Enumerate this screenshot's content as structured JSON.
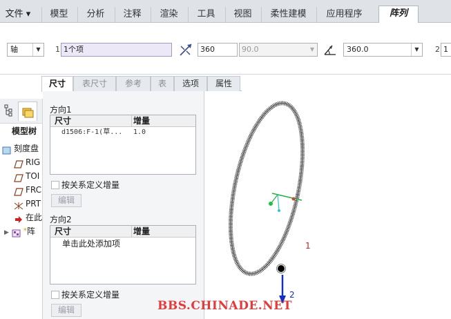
{
  "ribbon": {
    "file_menu": "文件",
    "tabs": [
      "模型",
      "分析",
      "注释",
      "渲染",
      "工具",
      "视图",
      "柔性建模",
      "应用程序"
    ],
    "active_tab": "阵列"
  },
  "dashboard": {
    "type_select": "轴",
    "dir1_num": "1",
    "dir1_ref": "1个项",
    "count1": "360",
    "angle1": "90.0",
    "angle_range": "360.0",
    "dir2_num": "2",
    "dir2_value": "1"
  },
  "subtabs": [
    "尺寸",
    "表尺寸",
    "参考",
    "表",
    "选项",
    "属性"
  ],
  "tree": {
    "title": "模型树",
    "items": [
      {
        "label": "刻度盘",
        "icon": "part-icon"
      },
      {
        "label": "RIG",
        "icon": "datum-plane-icon"
      },
      {
        "label": "TOI",
        "icon": "datum-plane-icon"
      },
      {
        "label": "FRC",
        "icon": "datum-plane-icon"
      },
      {
        "label": "PRT",
        "icon": "csys-icon"
      },
      {
        "label": "在此",
        "icon": "insert-arrow-icon"
      },
      {
        "label": "阵",
        "icon": "pattern-icon"
      }
    ]
  },
  "panel": {
    "dir1_title": "方向1",
    "dir1_header": [
      "尺寸",
      "增量"
    ],
    "dir1_rows": [
      {
        "dim": "d1506:F-1(草...",
        "inc": "1.0"
      }
    ],
    "relation1": "按关系定义增量",
    "edit1": "编辑",
    "dir2_title": "方向2",
    "dir2_header": [
      "尺寸",
      "增量"
    ],
    "dir2_placeholder": "单击此处添加项",
    "relation2": "按关系定义增量",
    "edit2": "编辑"
  },
  "graphics": {
    "label1": "1",
    "label2": "2"
  },
  "watermark": "BBS.CHINADE.NET"
}
